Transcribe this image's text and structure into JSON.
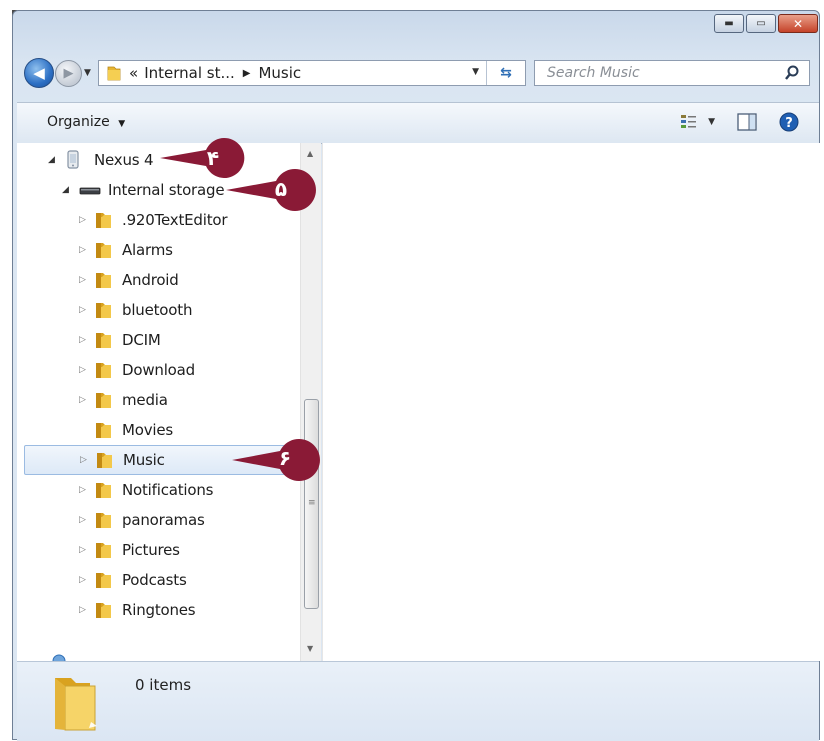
{
  "window": {
    "caption_buttons": [
      "minimize",
      "maximize",
      "close"
    ]
  },
  "nav": {
    "address_overflow": "«",
    "address_crumb": "Internal st...",
    "address_current": "Music",
    "search_placeholder": "Search Music"
  },
  "toolbar": {
    "organize_label": "Organize"
  },
  "tree": {
    "device": "Nexus 4",
    "storage": "Internal storage",
    "folders": [
      ".920TextEditor",
      "Alarms",
      "Android",
      "bluetooth",
      "DCIM",
      "Download",
      "media",
      "Movies",
      "Music",
      "Notifications",
      "panoramas",
      "Pictures",
      "Podcasts",
      "Ringtones"
    ],
    "selected": "Music"
  },
  "details": {
    "item_count": "0 items"
  },
  "callouts": [
    "۴",
    "۵",
    "۶"
  ],
  "colors": {
    "callout": "#8a1a36",
    "folder": "#e8b631",
    "selection_border": "#9bbbe2",
    "accent_blue": "#2c6fc4"
  }
}
